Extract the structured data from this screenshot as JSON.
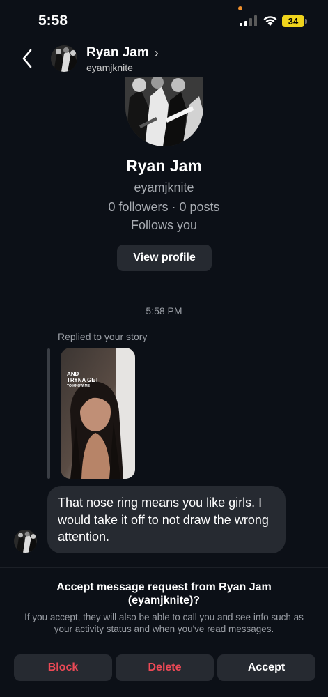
{
  "status_bar": {
    "time": "5:58",
    "battery": "34"
  },
  "header": {
    "name": "Ryan Jam",
    "username": "eyamjknite"
  },
  "profile": {
    "name": "Ryan Jam",
    "username": "eyamjknite",
    "stats": "0 followers · 0 posts",
    "follows_you": "Follows you",
    "view_profile_label": "View profile"
  },
  "conversation": {
    "timestamp": "5:58 PM",
    "replied_label": "Replied to your story",
    "story_overlay_line1": "AND",
    "story_overlay_line2": "TRYNA GET",
    "story_overlay_line3": "TO KNOW ME",
    "message": "That nose ring means you like girls. I would take it off to not draw the wrong attention."
  },
  "request": {
    "title": "Accept message request from Ryan Jam (eyamjknite)?",
    "description": "If you accept, they will also be able to call you and see info such as your activity status and when you've read messages.",
    "block_label": "Block",
    "delete_label": "Delete",
    "accept_label": "Accept"
  },
  "colors": {
    "background": "#0c1017",
    "bubble": "#262a31",
    "danger": "#ed4956",
    "muted": "#9a9ea5",
    "battery": "#f0d41c"
  }
}
